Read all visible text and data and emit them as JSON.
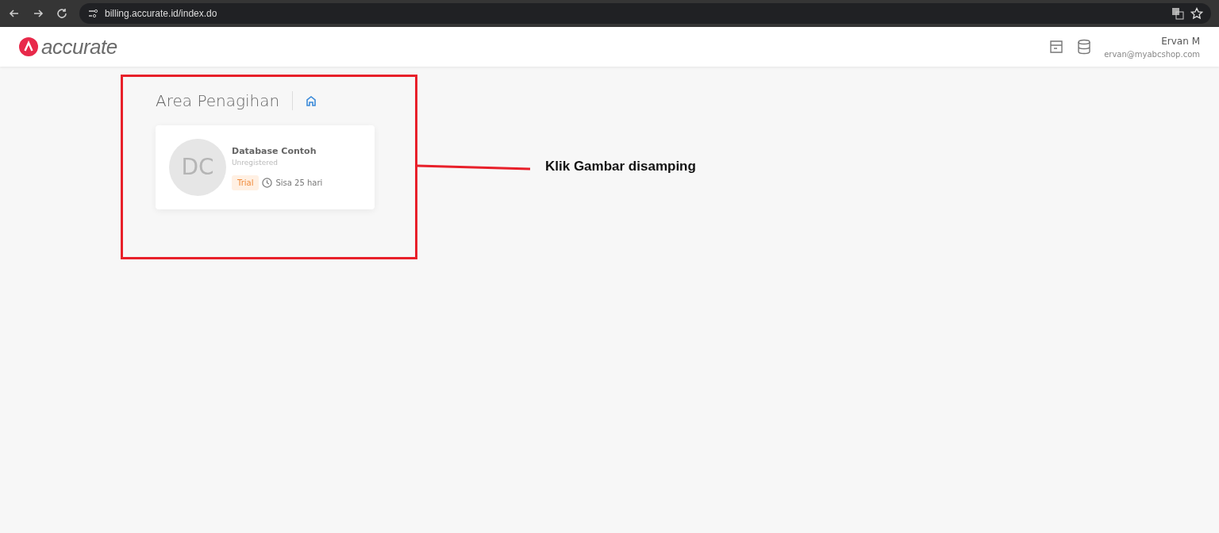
{
  "browser": {
    "url": "billing.accurate.id/index.do"
  },
  "header": {
    "logo_text": "accurate",
    "user_name": "Ervan M",
    "user_email": "ervan@myabcshop.com"
  },
  "page": {
    "title": "Area Penagihan"
  },
  "databases": [
    {
      "initials": "DC",
      "name": "Database Contoh",
      "status": "Unregistered",
      "badge": "Trial",
      "remaining": "Sisa 25 hari"
    }
  ],
  "annotation": {
    "text": "Klik Gambar disamping",
    "color": "#e8202a"
  }
}
